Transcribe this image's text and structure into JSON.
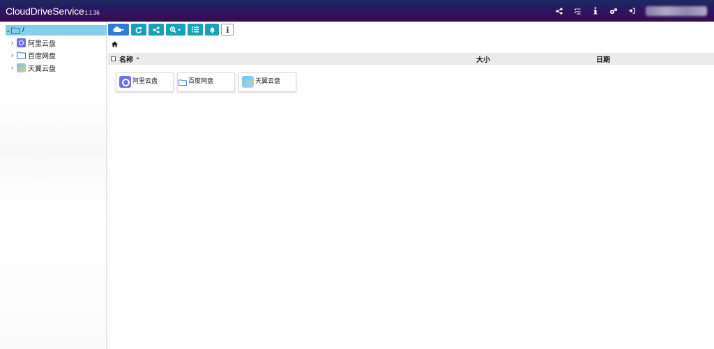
{
  "app": {
    "title": "CloudDriveService",
    "version": "1.1.36"
  },
  "topbar": {
    "icons": [
      "share-icon",
      "task-list-icon",
      "info-icon",
      "settings-icon",
      "logout-icon"
    ],
    "gradient_colors": [
      "#1d2a63",
      "#3a0b52"
    ]
  },
  "sidebar": {
    "root_label": "/",
    "selected_color": "#87ceeb",
    "items": [
      {
        "label": "阿里云盘",
        "icon": "aliyun-drive-icon"
      },
      {
        "label": "百度网盘",
        "icon": "folder-icon"
      },
      {
        "label": "天翼云盘",
        "icon": "tianyi-cloud-icon"
      }
    ]
  },
  "toolbar": {
    "buttons": [
      "cloud-menu-icon",
      "refresh-icon",
      "share-icon",
      "zoom-menu-icon",
      "list-view-icon",
      "bell-icon",
      "info-icon"
    ],
    "accent": "#17a2b8",
    "primary": "#2f7fd0"
  },
  "breadcrumb": {
    "icon": "home-icon"
  },
  "table": {
    "columns": {
      "name": "名称",
      "sort_indicator": "⌃",
      "size": "大小",
      "date": "日期"
    }
  },
  "files": [
    {
      "label": "阿里云盘",
      "icon": "aliyun-drive-icon"
    },
    {
      "label": "百度网盘",
      "icon": "folder-icon"
    },
    {
      "label": "天翼云盘",
      "icon": "tianyi-cloud-icon"
    }
  ]
}
